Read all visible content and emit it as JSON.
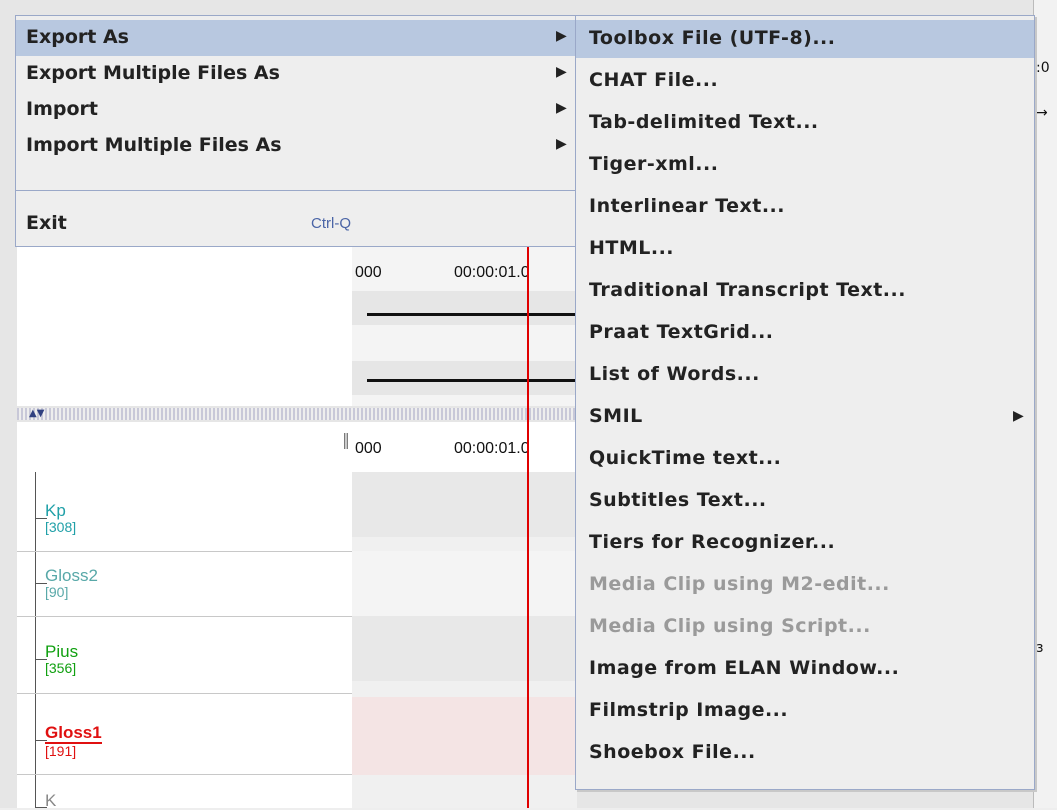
{
  "menu": {
    "items": [
      {
        "label": "Export As",
        "selected": true,
        "has_submenu": true
      },
      {
        "label": "Export Multiple Files As",
        "has_submenu": true
      },
      {
        "label": "Import",
        "has_submenu": true
      },
      {
        "label": "Import Multiple Files As",
        "has_submenu": true
      }
    ],
    "exit": {
      "label": "Exit",
      "accelerator": "Ctrl-Q"
    }
  },
  "submenu": {
    "items": [
      {
        "label": "Toolbox File (UTF-8)...",
        "selected": true
      },
      {
        "label": "CHAT File..."
      },
      {
        "label": "Tab-delimited Text..."
      },
      {
        "label": "Tiger-xml..."
      },
      {
        "label": "Interlinear Text..."
      },
      {
        "label": "HTML..."
      },
      {
        "label": "Traditional Transcript Text..."
      },
      {
        "label": "Praat TextGrid..."
      },
      {
        "label": "List of Words..."
      },
      {
        "label": "SMIL",
        "has_submenu": true
      },
      {
        "label": "QuickTime text..."
      },
      {
        "label": "Subtitles Text..."
      },
      {
        "label": "Tiers for Recognizer..."
      },
      {
        "label": "Media Clip using M2-edit...",
        "disabled": true
      },
      {
        "label": "Media Clip using Script...",
        "disabled": true
      },
      {
        "label": "Image from ELAN Window..."
      },
      {
        "label": "Filmstrip Image..."
      },
      {
        "label": "Shoebox File..."
      }
    ]
  },
  "timeline": {
    "tick_left": "000",
    "tick_right": "00:00:01.0"
  },
  "tiers": [
    {
      "name": "Kp",
      "count": "[308]",
      "color": "#20a0a8"
    },
    {
      "name": "Gloss2",
      "count": "[90]",
      "color": "#58a8a8"
    },
    {
      "name": "Pius",
      "count": "[356]",
      "color": "#10a010"
    },
    {
      "name": "Gloss1",
      "count": "[191]",
      "color": "#e01010",
      "active": true
    },
    {
      "name": "K",
      "count": "",
      "color": "#888888"
    }
  ],
  "colors": {
    "menu_bg": "#eeeeee",
    "selection": "#b8c8e0",
    "accelerator": "#4a64a6",
    "disabled": "#9a9a9a",
    "crosshair": "#e00000"
  }
}
